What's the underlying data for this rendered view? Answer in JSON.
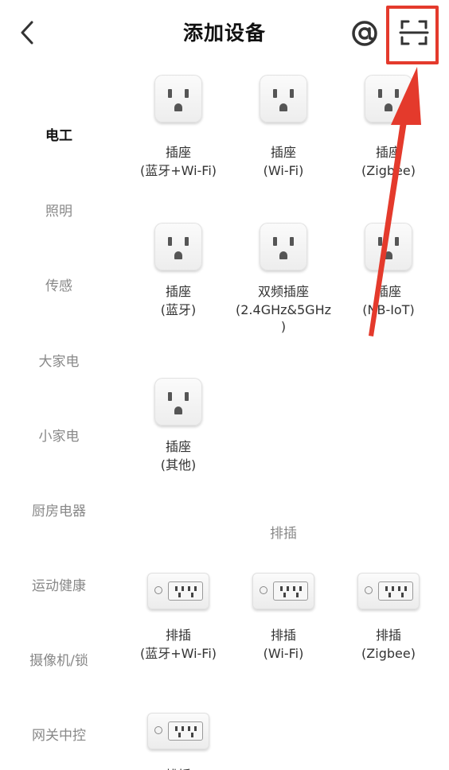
{
  "header": {
    "title": "添加设备",
    "icons": [
      "back-icon",
      "at-icon",
      "scan-icon"
    ]
  },
  "sidebar": {
    "items": [
      {
        "label": "电工",
        "active": true
      },
      {
        "label": "照明",
        "active": false
      },
      {
        "label": "传感",
        "active": false
      },
      {
        "label": "大家电",
        "active": false
      },
      {
        "label": "小家电",
        "active": false
      },
      {
        "label": "厨房电器",
        "active": false
      },
      {
        "label": "运动健康",
        "active": false
      },
      {
        "label": "摄像机/锁",
        "active": false
      },
      {
        "label": "网关中控",
        "active": false
      }
    ]
  },
  "sockets": [
    {
      "line1": "插座",
      "line2": "(蓝牙+Wi-Fi)"
    },
    {
      "line1": "插座",
      "line2": "(Wi-Fi)"
    },
    {
      "line1": "插座",
      "line2": "(Zigbee)"
    },
    {
      "line1": "插座",
      "line2": "(蓝牙)"
    },
    {
      "line1": "双频插座",
      "line2": "(2.4GHz&5GHz",
      "line3": ")"
    },
    {
      "line1": "插座",
      "line2": "(NB-IoT)"
    },
    {
      "line1": "插座",
      "line2": "(其他)"
    }
  ],
  "strips_section": {
    "title": "排插",
    "items": [
      {
        "line1": "排插",
        "line2": "(蓝牙+Wi-Fi)"
      },
      {
        "line1": "排插",
        "line2": "(Wi-Fi)"
      },
      {
        "line1": "排插",
        "line2": "(Zigbee)"
      },
      {
        "line1": "排插",
        "line2": ""
      }
    ]
  },
  "colors": {
    "highlight": "#e43a2c",
    "active_text": "#111111",
    "inactive_text": "#888888"
  }
}
